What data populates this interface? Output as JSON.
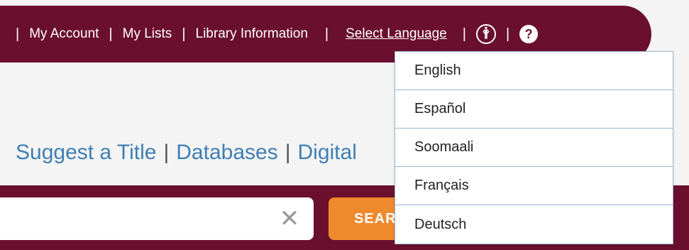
{
  "utility_bar": {
    "my_account": "My Account",
    "my_lists": "My Lists",
    "library_information": "Library Information",
    "select_language": "Select Language",
    "separator": "|",
    "accessibility_icon": "accessibility-icon",
    "help_icon": "help-icon",
    "accessibility_glyph": "🛉",
    "help_glyph": "?",
    "background_color": "#6b0f2f"
  },
  "nav_links": {
    "suggest_title": "Suggest a Title",
    "databases": "Databases",
    "digital": "Digital",
    "separator": "|"
  },
  "search": {
    "input_value": "",
    "placeholder": "",
    "clear_glyph": "✕",
    "button_label": "SEARCH",
    "button_color": "#ee8a2d"
  },
  "language_menu": {
    "options": [
      {
        "label": "English"
      },
      {
        "label": "Español"
      },
      {
        "label": "Soomaali"
      },
      {
        "label": "Français"
      },
      {
        "label": "Deutsch"
      }
    ]
  }
}
